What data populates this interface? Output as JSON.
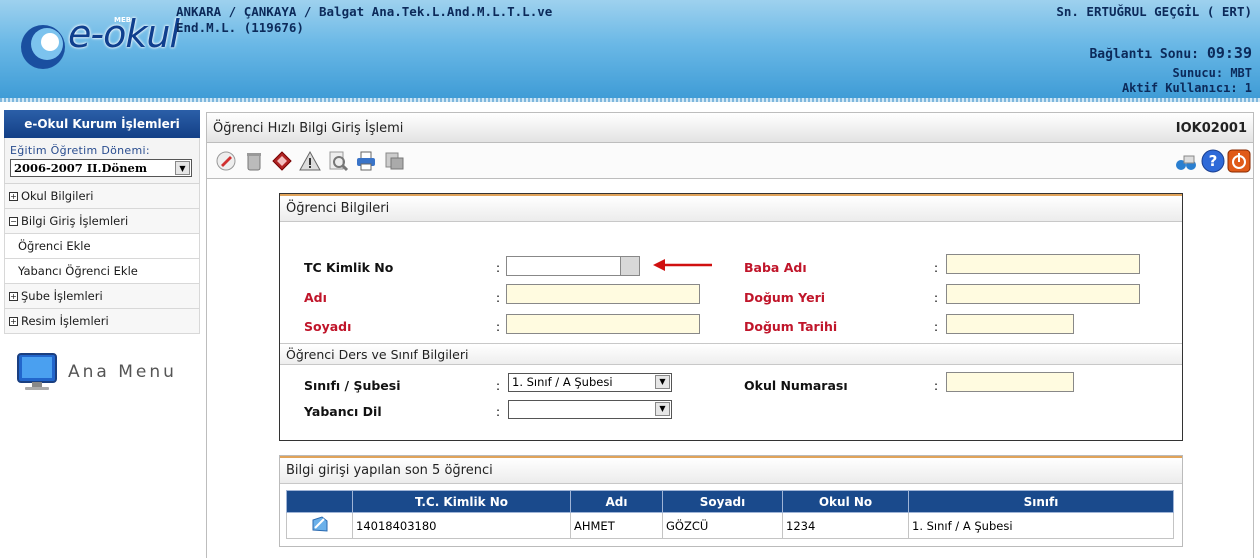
{
  "header": {
    "logo_small": "MEB",
    "logo_text": "e-okul",
    "school_line1": "ANKARA / ÇANKAYA / Balgat Ana.Tek.L.And.M.L.T.L.ve",
    "school_line2": "End.M.L. (119676)",
    "user": "Sn. ERTUĞRUL GEÇGİL ( ERT)",
    "conn_label": "Bağlantı Sonu:",
    "conn_time": "09:39",
    "server": "Sunucu: MBT",
    "active_users": "Aktif Kullanıcı: 1"
  },
  "sidebar": {
    "title": "e-Okul Kurum İşlemleri",
    "term_label": "Eğitim Öğretim Dönemi:",
    "term_value": "2006-2007 II.Dönem",
    "items": [
      {
        "label": "Okul Bilgileri"
      },
      {
        "label": "Bilgi Giriş İşlemleri"
      },
      {
        "label": "Öğrenci Ekle"
      },
      {
        "label": "Yabancı Öğrenci Ekle"
      },
      {
        "label": "Şube İşlemleri"
      },
      {
        "label": "Resim İşlemleri"
      }
    ],
    "ana_menu": "Ana Menu"
  },
  "main": {
    "title": "Öğrenci Hızlı Bilgi Giriş İşlemi",
    "code": "IOK02001"
  },
  "form": {
    "section1": "Öğrenci Bilgileri",
    "tc_label": "TC Kimlik No",
    "ad_label": "Adı",
    "soyad_label": "Soyadı",
    "baba_label": "Baba Adı",
    "dogum_yeri_label": "Doğum Yeri",
    "dogum_tarihi_label": "Doğum Tarihi",
    "colon": ":",
    "section2": "Öğrenci Ders ve Sınıf Bilgileri",
    "sinif_label": "Sınıfı / Şubesi",
    "sinif_value": "1. Sınıf / A Şubesi",
    "dil_label": "Yabancı Dil",
    "dil_value": "",
    "okul_no_label": "Okul Numarası"
  },
  "recent": {
    "title": "Bilgi girişi yapılan son 5 öğrenci",
    "columns": [
      "",
      "T.C. Kimlik No",
      "Adı",
      "Soyadı",
      "Okul No",
      "Sınıfı"
    ],
    "rows": [
      {
        "tc": "14018403180",
        "ad": "AHMET",
        "soyad": "GÖZCÜ",
        "okul_no": "1234",
        "sinif": "1. Sınıf / A Şubesi"
      }
    ]
  },
  "colors": {
    "header_blue": "#3f9cd6",
    "nav_dark": "#133f86",
    "required_red": "#c0152a",
    "input_yellow": "#fffbe0",
    "arrow_red": "#d01010"
  }
}
